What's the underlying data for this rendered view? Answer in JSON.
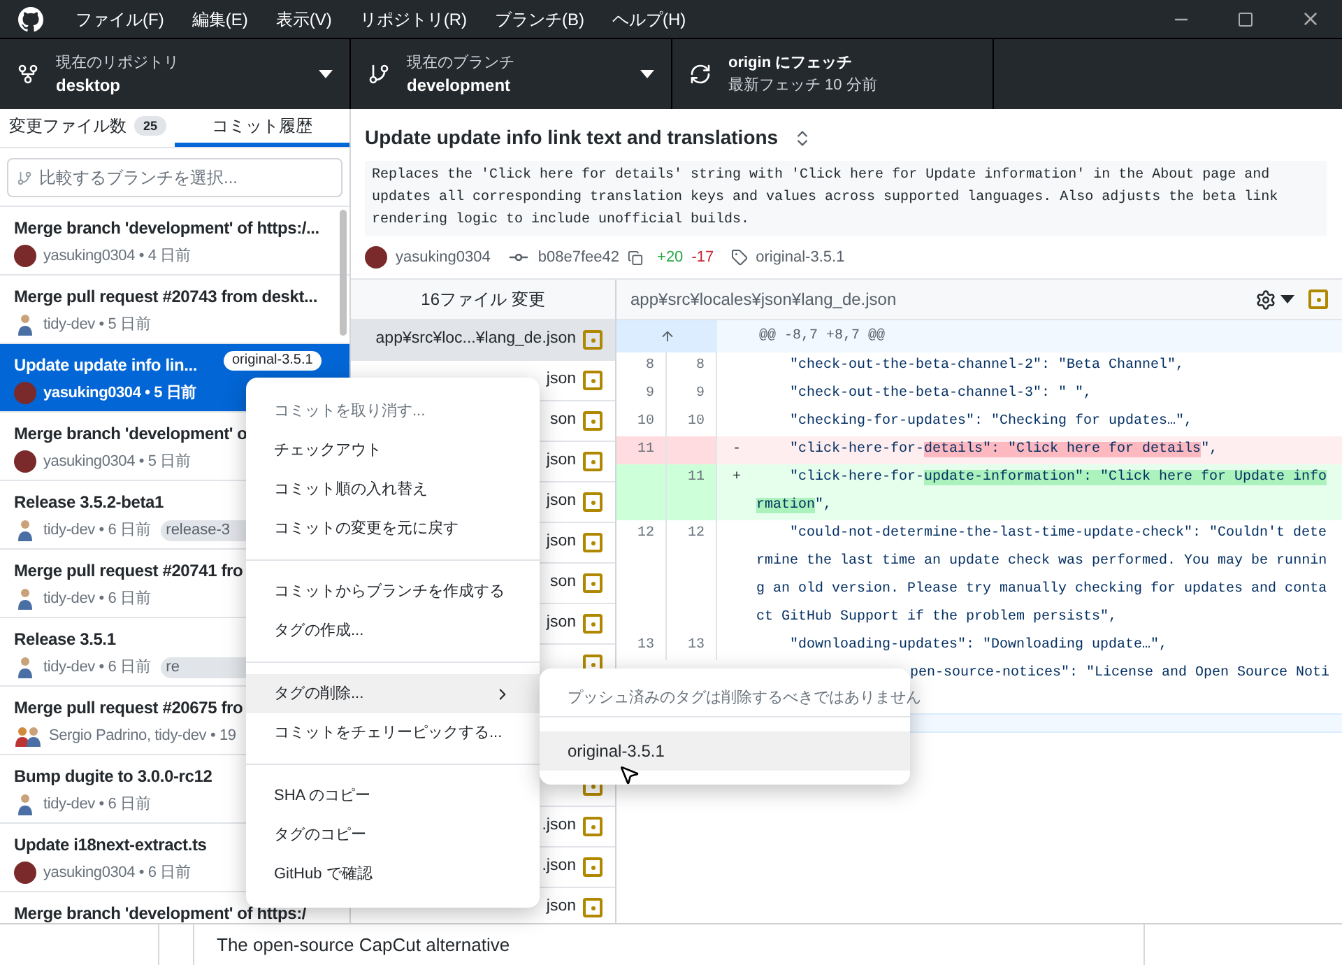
{
  "menu_bar": [
    "ファイル(F)",
    "編集(E)",
    "表示(V)",
    "リポジトリ(R)",
    "ブランチ(B)",
    "ヘルプ(H)"
  ],
  "toolbar": [
    {
      "kind": "repository",
      "label": "現在のリポジトリ",
      "value": "desktop"
    },
    {
      "kind": "branch",
      "label": "現在のブランチ",
      "value": "development"
    },
    {
      "kind": "fetch",
      "label": "origin にフェッチ",
      "value": "最新フェッチ 10 分前"
    }
  ],
  "tabs": [
    {
      "label": "変更ファイル数",
      "count": "25",
      "selected": false
    },
    {
      "label": "コミット履歴",
      "selected": true
    }
  ],
  "branch_filter": {
    "placeholder": "比較するブランチを選択..."
  },
  "commits": [
    {
      "title": "Merge branch 'development' of https:/...",
      "meta": "yasuking0304 • 4 日前",
      "avatar": {
        "kind": "photo"
      },
      "selected": false
    },
    {
      "title": "Merge pull request #20743 from deskt...",
      "meta": "tidy-dev • 5 日前",
      "avatar": {
        "kind": "figure"
      },
      "selected": false
    },
    {
      "title": "Update update info lin...",
      "meta": "yasuking0304 • 5 日前",
      "avatar": {
        "kind": "photo"
      },
      "selected": true,
      "tag": "original-3.5.1"
    },
    {
      "title": "Merge branch 'development' o",
      "meta": "yasuking0304 • 5 日前",
      "avatar": {
        "kind": "photo"
      },
      "selected": false
    },
    {
      "title": "Release 3.5.2-beta1",
      "meta": "tidy-dev • 6 日前",
      "avatar": {
        "kind": "figure"
      },
      "selected": false,
      "tag": "release-3"
    },
    {
      "title": "Merge pull request #20741 fro",
      "meta": "tidy-dev • 6 日前",
      "avatar": {
        "kind": "figure"
      },
      "selected": false
    },
    {
      "title": "Release 3.5.1",
      "meta": "tidy-dev • 6 日前",
      "avatar": {
        "kind": "figure"
      },
      "selected": false,
      "tag": "re"
    },
    {
      "title": "Merge pull request #20675 fro",
      "meta": "Sergio Padrino, tidy-dev • 19",
      "avatar": {
        "kind": "pair"
      },
      "selected": false
    },
    {
      "title": "Bump dugite to 3.0.0-rc12",
      "meta": "tidy-dev • 6 日前",
      "avatar": {
        "kind": "figure"
      },
      "selected": false
    },
    {
      "title": "Update i18next-extract.ts",
      "meta": "yasuking0304 • 6 日前",
      "avatar": {
        "kind": "photo"
      },
      "selected": false
    },
    {
      "title": "Merge branch 'development' of https:/",
      "selected": false
    }
  ],
  "commit": {
    "title": "Update update info link text and translations",
    "description": "Replaces the 'Click here for details' string with 'Click here for Update information' in the About page and updates all corresponding translation keys and values across supported languages. Also adjusts the beta link rendering logic to include unofficial builds.",
    "author": "yasuking0304",
    "sha": "b08e7fee42",
    "additions": "+20",
    "deletions": "-17",
    "tag": "original-3.5.1"
  },
  "files": {
    "header": "16ファイル 変更",
    "items": [
      {
        "kind": "file",
        "name": "app¥src¥loc...¥lang_de.json",
        "selected": true
      },
      {
        "kind": "file",
        "name": "json",
        "selected": false
      },
      {
        "kind": "file",
        "name": "son",
        "selected": false
      },
      {
        "kind": "file",
        "name": "json",
        "selected": false
      },
      {
        "kind": "file",
        "name": "json",
        "selected": false
      },
      {
        "kind": "file",
        "name": "json",
        "selected": false
      },
      {
        "kind": "file",
        "name": "son",
        "selected": false
      },
      {
        "kind": "file",
        "name": "json",
        "selected": false
      },
      {
        "kind": "covered"
      },
      {
        "kind": "covered"
      },
      {
        "kind": "covered"
      },
      {
        "kind": "covered"
      },
      {
        "kind": "file",
        "name": ".json",
        "selected": false
      },
      {
        "kind": "file",
        "name": ".json",
        "selected": false
      },
      {
        "kind": "file",
        "name": "json",
        "selected": false
      }
    ]
  },
  "diff": {
    "path": "app¥src¥locales¥json¥lang_de.json",
    "lines": [
      {
        "kind": "hunk",
        "text": "@@ -8,7 +8,7 @@"
      },
      {
        "kind": "context",
        "old": "8",
        "new": "8",
        "text": "\"check-out-the-beta-channel-2\": \"Beta Channel\","
      },
      {
        "kind": "context",
        "old": "9",
        "new": "9",
        "text": "\"check-out-the-beta-channel-3\": \" \","
      },
      {
        "kind": "context",
        "old": "10",
        "new": "10",
        "text": "\"checking-for-updates\": \"Checking for updates…\","
      },
      {
        "kind": "deleted",
        "old": "11",
        "marker": "-",
        "segments": [
          {
            "text": "\"click-here-for-",
            "highlight": false
          },
          {
            "text": "details\": \"Click here for details",
            "highlight": true
          },
          {
            "text": "\",",
            "highlight": false
          }
        ]
      },
      {
        "kind": "added",
        "new": "11",
        "marker": "+",
        "segments": [
          {
            "text": "\"click-here-for-",
            "highlight": false
          },
          {
            "text": "update-information\": \"Click here for Update information",
            "highlight": true
          },
          {
            "text": "\",",
            "highlight": false
          }
        ]
      },
      {
        "kind": "context",
        "old": "12",
        "new": "12",
        "text": "\"could-not-determine-the-last-time-update-check\": \"Couldn't determine the last time an update check was performed. You may be running an old version. Please try manually checking for updates and contact GitHub Support if the problem persists\","
      },
      {
        "kind": "context",
        "old": "13",
        "new": "13",
        "text": "\"downloading-updates\": \"Downloading update…\","
      },
      {
        "kind": "clipped",
        "text": "pen-source-notices\": \"License and Open Source Noti"
      },
      {
        "kind": "expander"
      }
    ]
  },
  "context_menu": {
    "groups": [
      [
        {
          "label": "コミットを取り消す...",
          "disabled": true,
          "highlighted": false
        },
        {
          "label": "チェックアウト",
          "disabled": false,
          "highlighted": false
        },
        {
          "label": "コミット順の入れ替え",
          "disabled": false,
          "highlighted": false
        },
        {
          "label": "コミットの変更を元に戻す",
          "disabled": false,
          "highlighted": false
        }
      ],
      [
        {
          "label": "コミットからブランチを作成する",
          "disabled": false,
          "highlighted": false
        },
        {
          "label": "タグの作成...",
          "disabled": false,
          "highlighted": false
        }
      ],
      [
        {
          "label": "タグの削除...",
          "disabled": false,
          "highlighted": true,
          "submenu": true
        },
        {
          "label": "コミットをチェリーピックする...",
          "disabled": false,
          "highlighted": false
        }
      ],
      [
        {
          "label": "SHA のコピー",
          "disabled": false,
          "highlighted": false
        },
        {
          "label": "タグのコピー",
          "disabled": false,
          "highlighted": false
        },
        {
          "label": "GitHub で確認",
          "disabled": false,
          "highlighted": false
        }
      ]
    ]
  },
  "submenu": {
    "note": "プッシュ済みのタグは削除するべきではありません",
    "items": [
      {
        "label": "original-3.5.1",
        "highlighted": true
      }
    ]
  },
  "background_page": {
    "tagline": "The open-source CapCut alternative"
  }
}
